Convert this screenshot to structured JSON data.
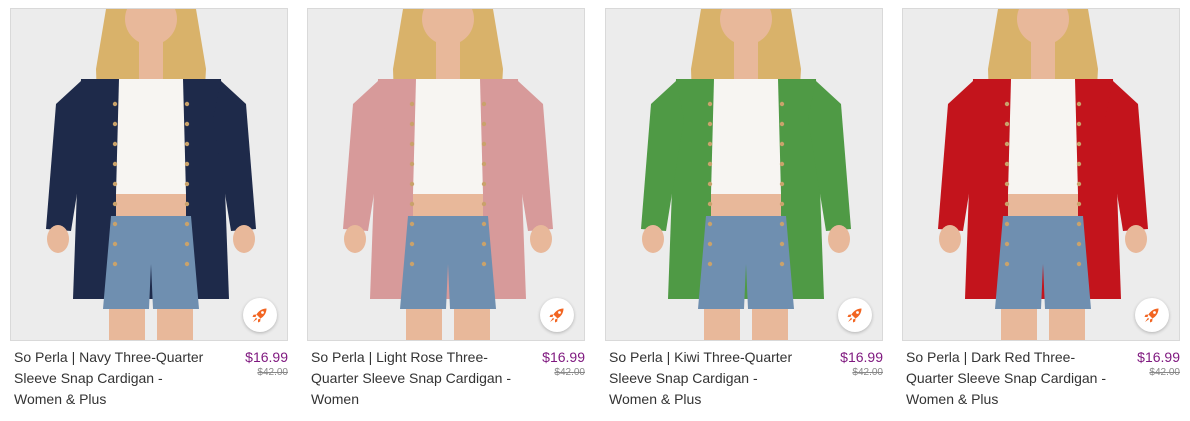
{
  "products": [
    {
      "title": "So Perla | Navy Three-Quarter Sleeve Snap Cardigan - Women & Plus",
      "price": "$16.99",
      "original_price": "$42.00",
      "cardigan_color": "#1e2a4a",
      "image_icon": "woman-in-navy-cardigan-image"
    },
    {
      "title": "So Perla | Light Rose Three-Quarter Sleeve Snap Cardigan - Women",
      "price": "$16.99",
      "original_price": "$42.00",
      "cardigan_color": "#d79a9a",
      "image_icon": "woman-in-light-rose-cardigan-image"
    },
    {
      "title": "So Perla | Kiwi Three-Quarter Sleeve Snap Cardigan - Women & Plus",
      "price": "$16.99",
      "original_price": "$42.00",
      "cardigan_color": "#4f9a45",
      "image_icon": "woman-in-kiwi-cardigan-image"
    },
    {
      "title": "So Perla | Dark Red Three-Quarter Sleeve Snap Cardigan - Women & Plus",
      "price": "$16.99",
      "original_price": "$42.00",
      "cardigan_color": "#c3141c",
      "image_icon": "woman-in-dark-red-cardigan-image"
    }
  ],
  "colors": {
    "price": "#7f187f",
    "boost_icon": "#f26522",
    "skin": "#e8b89a",
    "hair": "#d9b26a",
    "top": "#f7f5f2",
    "denim": "#6f8fb0"
  },
  "boost_icon": "rocket-icon"
}
